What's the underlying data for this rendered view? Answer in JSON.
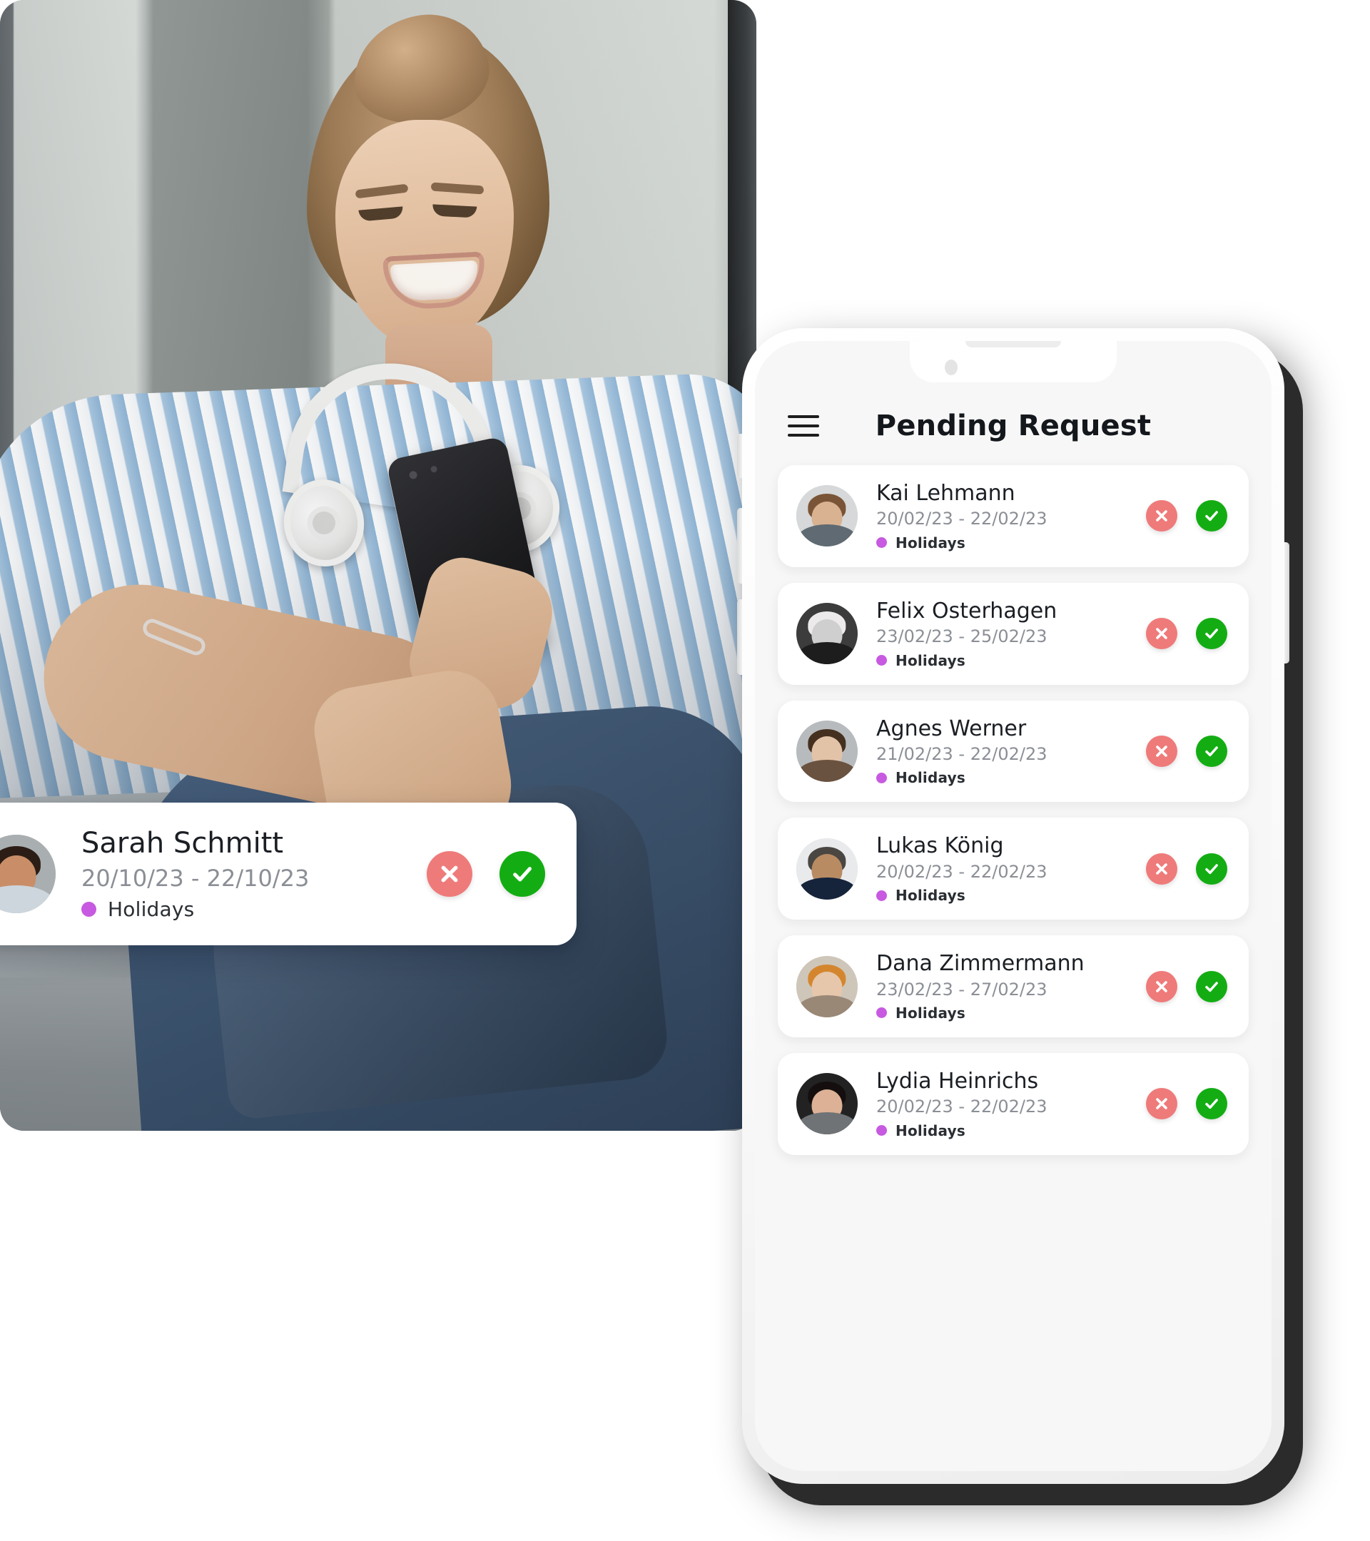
{
  "hero_photo": {
    "alt": "woman sitting on couch smiling at smartphone with headphones around neck"
  },
  "phone": {
    "hardware": {
      "speaker": "earpiece-speaker",
      "camera": "front-camera",
      "mute_switch": "mute-switch",
      "volume_up": "volume-up-button",
      "volume_down": "volume-down-button",
      "power": "power-button"
    }
  },
  "app": {
    "menu_icon": "hamburger-menu-icon",
    "title": "Pending Request",
    "request_type_label": "Holidays",
    "request_type_color": "#c75ae0",
    "reject_icon": "x-circle-icon",
    "accept_icon": "check-circle-icon",
    "reject_color": "#ef7a7a",
    "accept_color": "#13ad13",
    "requests": [
      {
        "name": "Kai Lehmann",
        "dates": "20/02/23 - 22/02/23",
        "type": "Holidays",
        "avatar": {
          "bg": "#d6d8d9",
          "skin": "#d8b291",
          "hair": "#7a5436",
          "body": "#5f6a72"
        }
      },
      {
        "name": "Felix Osterhagen",
        "dates": "23/02/23 - 25/02/23",
        "type": "Holidays",
        "avatar": {
          "bg": "#3c3c3c",
          "skin": "#cfcfcf",
          "hair": "#eceaea",
          "body": "#1d1d1d"
        }
      },
      {
        "name": "Agnes Werner",
        "dates": "21/02/23 - 22/02/23",
        "type": "Holidays",
        "avatar": {
          "bg": "#b7bbbe",
          "skin": "#e3c3a8",
          "hair": "#45301f",
          "body": "#6a5240"
        }
      },
      {
        "name": "Lukas König",
        "dates": "20/02/23 - 22/02/23",
        "type": "Holidays",
        "avatar": {
          "bg": "#e9eaec",
          "skin": "#b98b63",
          "hair": "#4a4642",
          "body": "#15233b"
        }
      },
      {
        "name": "Dana Zimmermann",
        "dates": "23/02/23 - 27/02/23",
        "type": "Holidays",
        "avatar": {
          "bg": "#cfc6ba",
          "skin": "#e6c7ac",
          "hair": "#d4862f",
          "body": "#9a8877"
        }
      },
      {
        "name": "Lydia Heinrichs",
        "dates": "20/02/23 - 22/02/23",
        "type": "Holidays",
        "avatar": {
          "bg": "#222222",
          "skin": "#dcb195",
          "hair": "#140f0e",
          "body": "#6f7376"
        }
      }
    ],
    "highlighted_request": {
      "name": "Sarah Schmitt",
      "dates": "20/10/23 - 22/10/23",
      "type": "Holidays",
      "avatar": {
        "bg": "#a9aeb1",
        "skin": "#c98e68",
        "hair": "#2b1d15",
        "body": "#cdd6dd"
      }
    }
  }
}
